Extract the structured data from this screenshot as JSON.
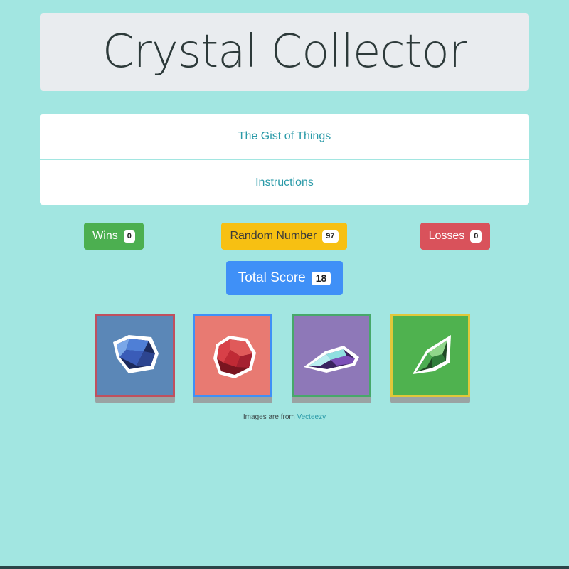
{
  "header": {
    "title": "Crystal Collector"
  },
  "accordion": {
    "items": [
      {
        "label": "The Gist of Things"
      },
      {
        "label": "Instructions"
      }
    ]
  },
  "stats": {
    "wins_label": "Wins",
    "wins_value": "0",
    "random_label": "Random Number",
    "random_value": "97",
    "losses_label": "Losses",
    "losses_value": "0",
    "score_label": "Total Score",
    "score_value": "18"
  },
  "crystals": [
    {
      "name": "blue-crystal",
      "bg": "#5b87b7",
      "border": "#c0505e"
    },
    {
      "name": "red-crystal",
      "bg": "#e87a72",
      "border": "#3f90f7"
    },
    {
      "name": "purple-crystal",
      "bg": "#8e78b8",
      "border": "#47a86a"
    },
    {
      "name": "green-crystal",
      "bg": "#4fb24f",
      "border": "#e0c83a"
    }
  ],
  "footer": {
    "credit_text": "Images are from",
    "credit_link": "Vecteezy"
  },
  "colors": {
    "background": "#a2e6e1",
    "wins": "#4caf50",
    "random": "#f7c012",
    "losses": "#d9525b",
    "score": "#3f90f7"
  }
}
